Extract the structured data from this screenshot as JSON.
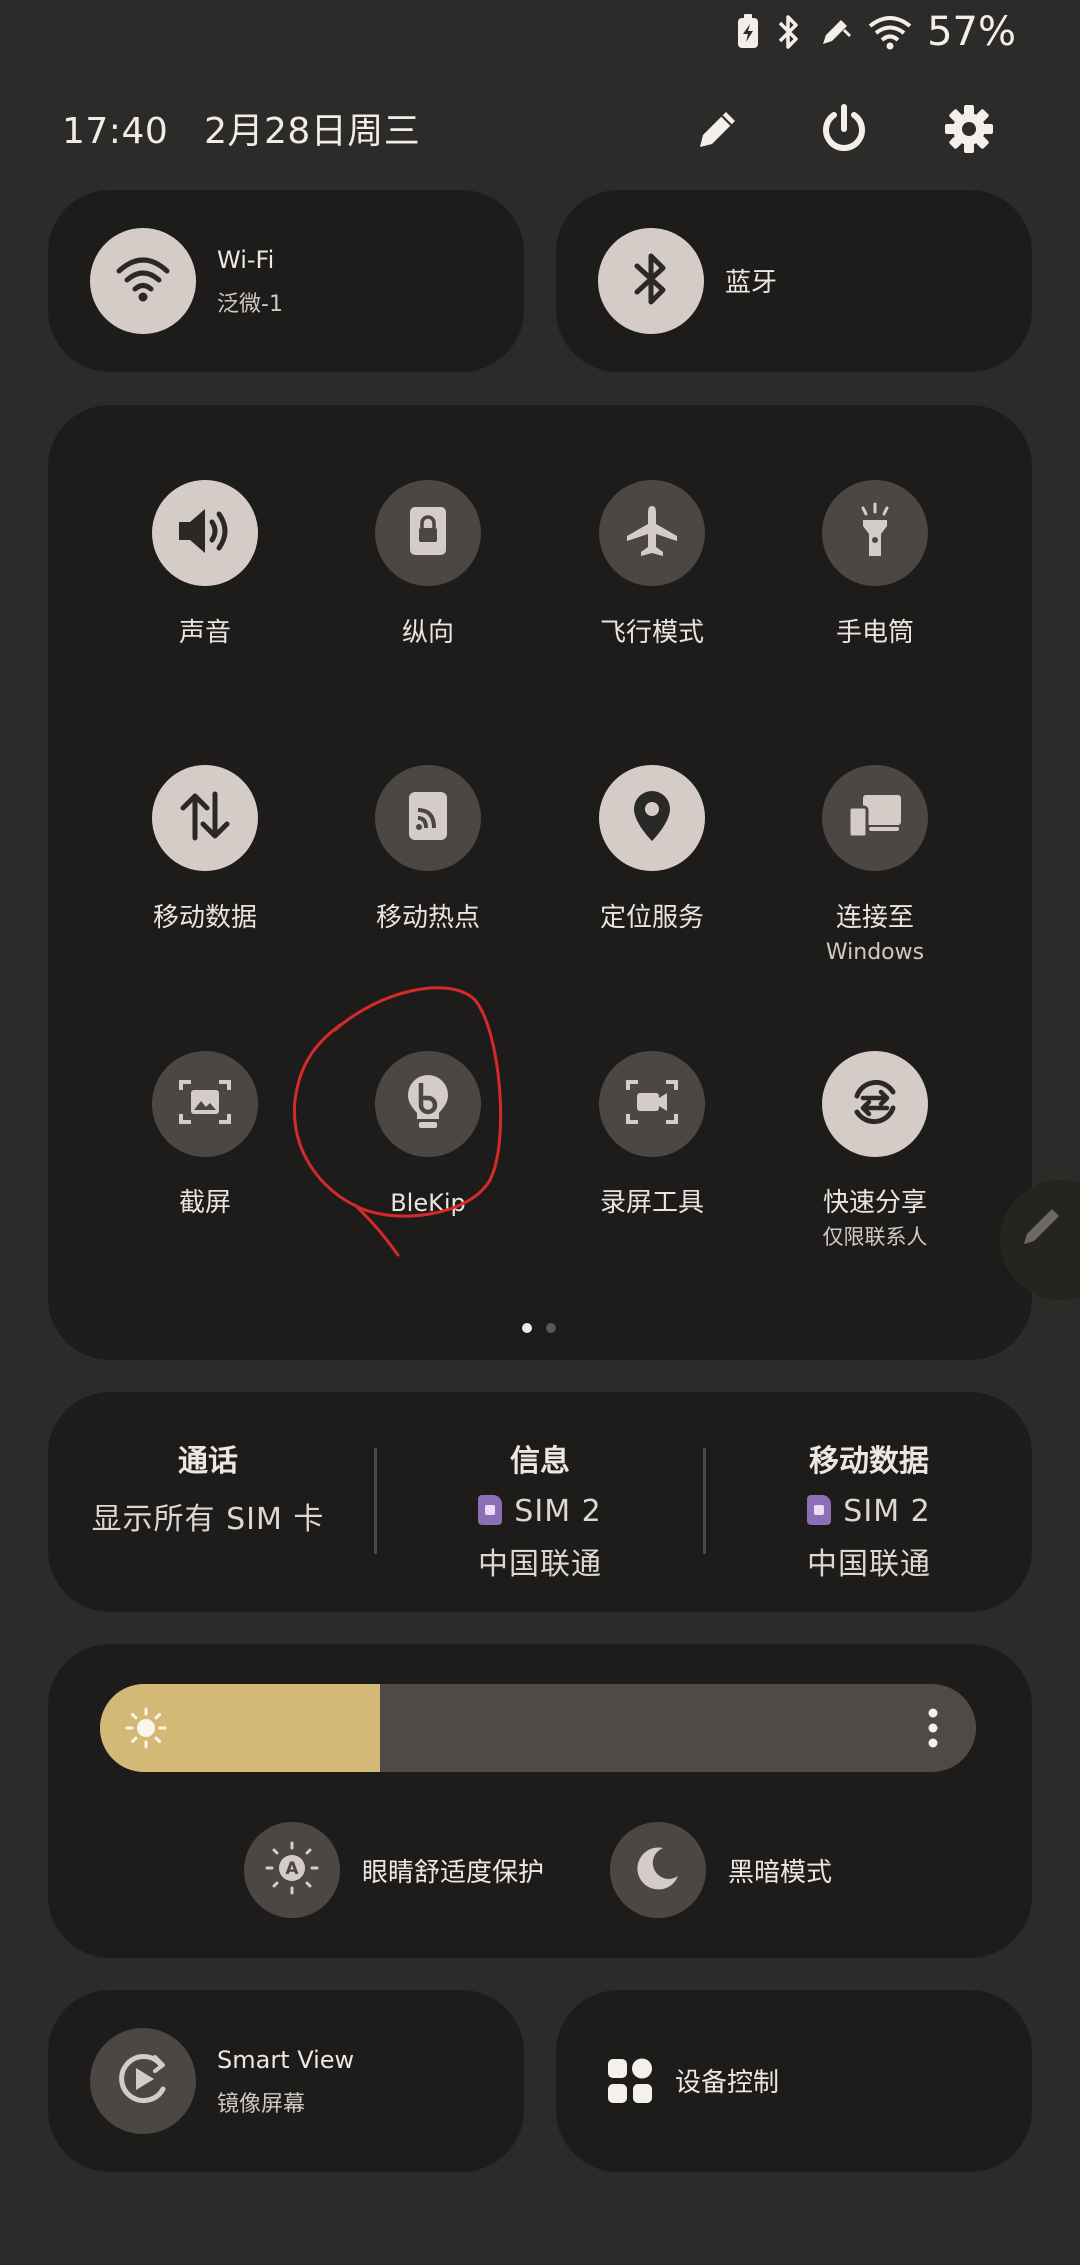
{
  "status_bar": {
    "battery": "57%"
  },
  "header": {
    "time": "17:40",
    "date": "2月28日周三"
  },
  "wifi": {
    "title": "Wi-Fi",
    "network": "泛微-1"
  },
  "bluetooth": {
    "title": "蓝牙"
  },
  "tiles": [
    {
      "label": "声音",
      "sub": "",
      "icon": "volume-icon",
      "state": "on"
    },
    {
      "label": "纵向",
      "sub": "",
      "icon": "lock-rotation-icon",
      "state": "off"
    },
    {
      "label": "飞行模式",
      "sub": "",
      "icon": "airplane-icon",
      "state": "off"
    },
    {
      "label": "手电筒",
      "sub": "",
      "icon": "flashlight-icon",
      "state": "off"
    },
    {
      "label": "移动数据",
      "sub": "",
      "icon": "mobile-data-icon",
      "state": "on"
    },
    {
      "label": "移动热点",
      "sub": "",
      "icon": "hotspot-icon",
      "state": "off"
    },
    {
      "label": "定位服务",
      "sub": "",
      "icon": "location-icon",
      "state": "on"
    },
    {
      "label": "连接至",
      "sub": "Windows",
      "icon": "link-to-windows-icon",
      "state": "off"
    },
    {
      "label": "截屏",
      "sub": "",
      "icon": "screenshot-icon",
      "state": "off"
    },
    {
      "label": "BleKip",
      "sub": "",
      "icon": "blekip-icon",
      "state": "off"
    },
    {
      "label": "录屏工具",
      "sub": "",
      "icon": "screen-record-icon",
      "state": "off"
    },
    {
      "label": "快速分享",
      "sub": "仅限联系人",
      "icon": "quick-share-icon",
      "state": "on"
    }
  ],
  "sim": {
    "calls_title": "通话",
    "calls_value": "显示所有 SIM 卡",
    "messages_title": "信息",
    "messages_sim": "SIM 2",
    "messages_carrier": "中国联通",
    "data_title": "移动数据",
    "data_sim": "SIM 2",
    "data_carrier": "中国联通"
  },
  "brightness": {
    "level": 0.32
  },
  "eye_comfort": {
    "label": "眼睛舒适度保护"
  },
  "dark_mode": {
    "label": "黑暗模式"
  },
  "smart_view": {
    "title": "Smart View",
    "sub": "镜像屏幕"
  },
  "device_control": {
    "label": "设备控制"
  },
  "colors": {
    "accent": "#d3b876",
    "tile_on": "#d6ccc7",
    "tile_off": "#4a4744",
    "annotation": "#d42a2a"
  }
}
